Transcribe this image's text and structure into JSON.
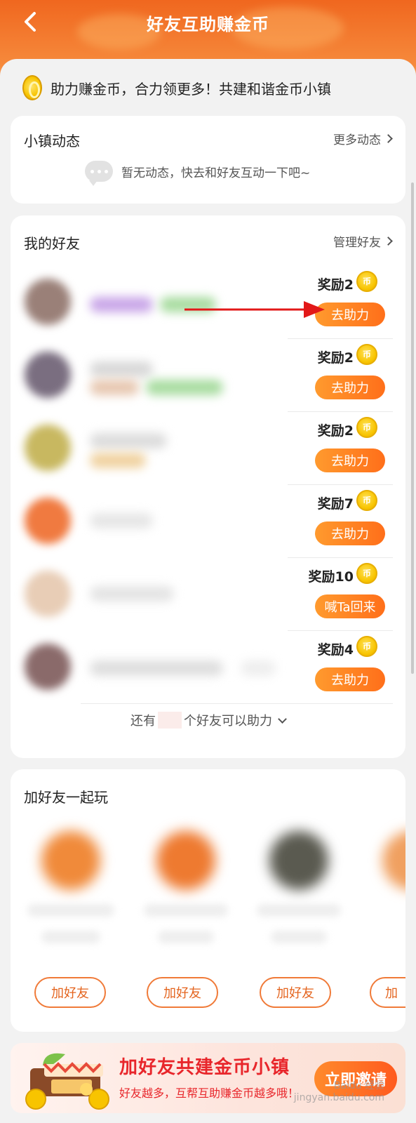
{
  "header": {
    "title": "好友互助赚金币"
  },
  "slogan": "助力赚金币，合力领更多！共建和谐金币小镇",
  "town_news": {
    "title": "小镇动态",
    "more_label": "更多动态",
    "empty_text": "暂无动态，快去和好友互动一下吧~"
  },
  "my_friends": {
    "title": "我的好友",
    "manage_label": "管理好友",
    "coin_glyph": "币",
    "rows": [
      {
        "reward": "奖励2",
        "action": "去助力"
      },
      {
        "reward": "奖励2",
        "action": "去助力"
      },
      {
        "reward": "奖励2",
        "action": "去助力"
      },
      {
        "reward": "奖励7",
        "action": "去助力"
      },
      {
        "reward": "奖励10",
        "action": "喊Ta回来"
      },
      {
        "reward": "奖励4",
        "action": "去助力"
      }
    ],
    "more_prefix": "还有",
    "more_suffix": "个好友可以助力"
  },
  "play_together": {
    "title": "加好友一起玩",
    "add_label": "加好友",
    "partial_label": "加"
  },
  "banner": {
    "title": "加好友共建金币小镇",
    "subtitle": "好友越多，互帮互助赚金币越多哦！",
    "invite_label": "立即邀请",
    "watermark": "Baidu 经验\njingyan.baidu.com"
  },
  "colors": {
    "accent": "#ff7a1e",
    "header_orange": "#f0671f",
    "banner_red": "#e8262b"
  }
}
